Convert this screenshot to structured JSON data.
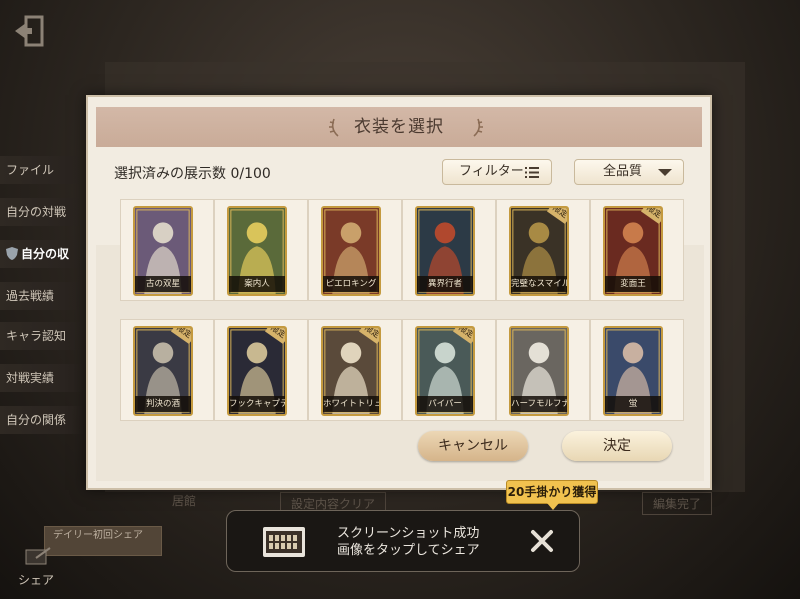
{
  "background": {
    "sidebar": [
      {
        "label": "ファイル",
        "active": false
      },
      {
        "label": "自分の対戦",
        "active": false
      },
      {
        "label": "自分の収",
        "active": true
      },
      {
        "label": "過去戦績",
        "active": false
      },
      {
        "label": "キャラ認知",
        "active": false
      },
      {
        "label": "対戦実績",
        "active": false
      },
      {
        "label": "自分の関係",
        "active": false
      }
    ],
    "bottom_left_label": "居館",
    "bottom_mid_label": "設定内容クリア",
    "bottom_right_label": "編集完了",
    "daily_button_label": "デイリー初回シェア",
    "share_label": "シェア"
  },
  "dialog": {
    "title": "衣装を選択",
    "count_label": "選択済みの展示数 0/100",
    "filter_label": "フィルター",
    "quality_label": "全品質",
    "cards": [
      {
        "name": "古の双星",
        "badge": ""
      },
      {
        "name": "案内人",
        "badge": ""
      },
      {
        "name": "ピエロキング",
        "badge": ""
      },
      {
        "name": "異界行者",
        "badge": ""
      },
      {
        "name": "完璧なスマイル",
        "badge": "限定"
      },
      {
        "name": "変面王",
        "badge": "限定"
      },
      {
        "name": "判決の酒",
        "badge": "限定"
      },
      {
        "name": "フックキャプテン",
        "badge": "限定"
      },
      {
        "name": "ホワイトトリュフ",
        "badge": "限定"
      },
      {
        "name": "パイパー",
        "badge": "限定"
      },
      {
        "name": "ハーフモルフナイト",
        "badge": ""
      },
      {
        "name": "蛍",
        "badge": ""
      }
    ],
    "cancel_label": "キャンセル",
    "confirm_label": "決定"
  },
  "toast": {
    "line1": "スクリーンショット成功",
    "line2": "画像をタップしてシェア",
    "reward": "20手掛かり獲得"
  },
  "colors": {
    "card_frame": "#c49a3f",
    "reward": "#f1c24f",
    "header": "#d3b8a7"
  }
}
